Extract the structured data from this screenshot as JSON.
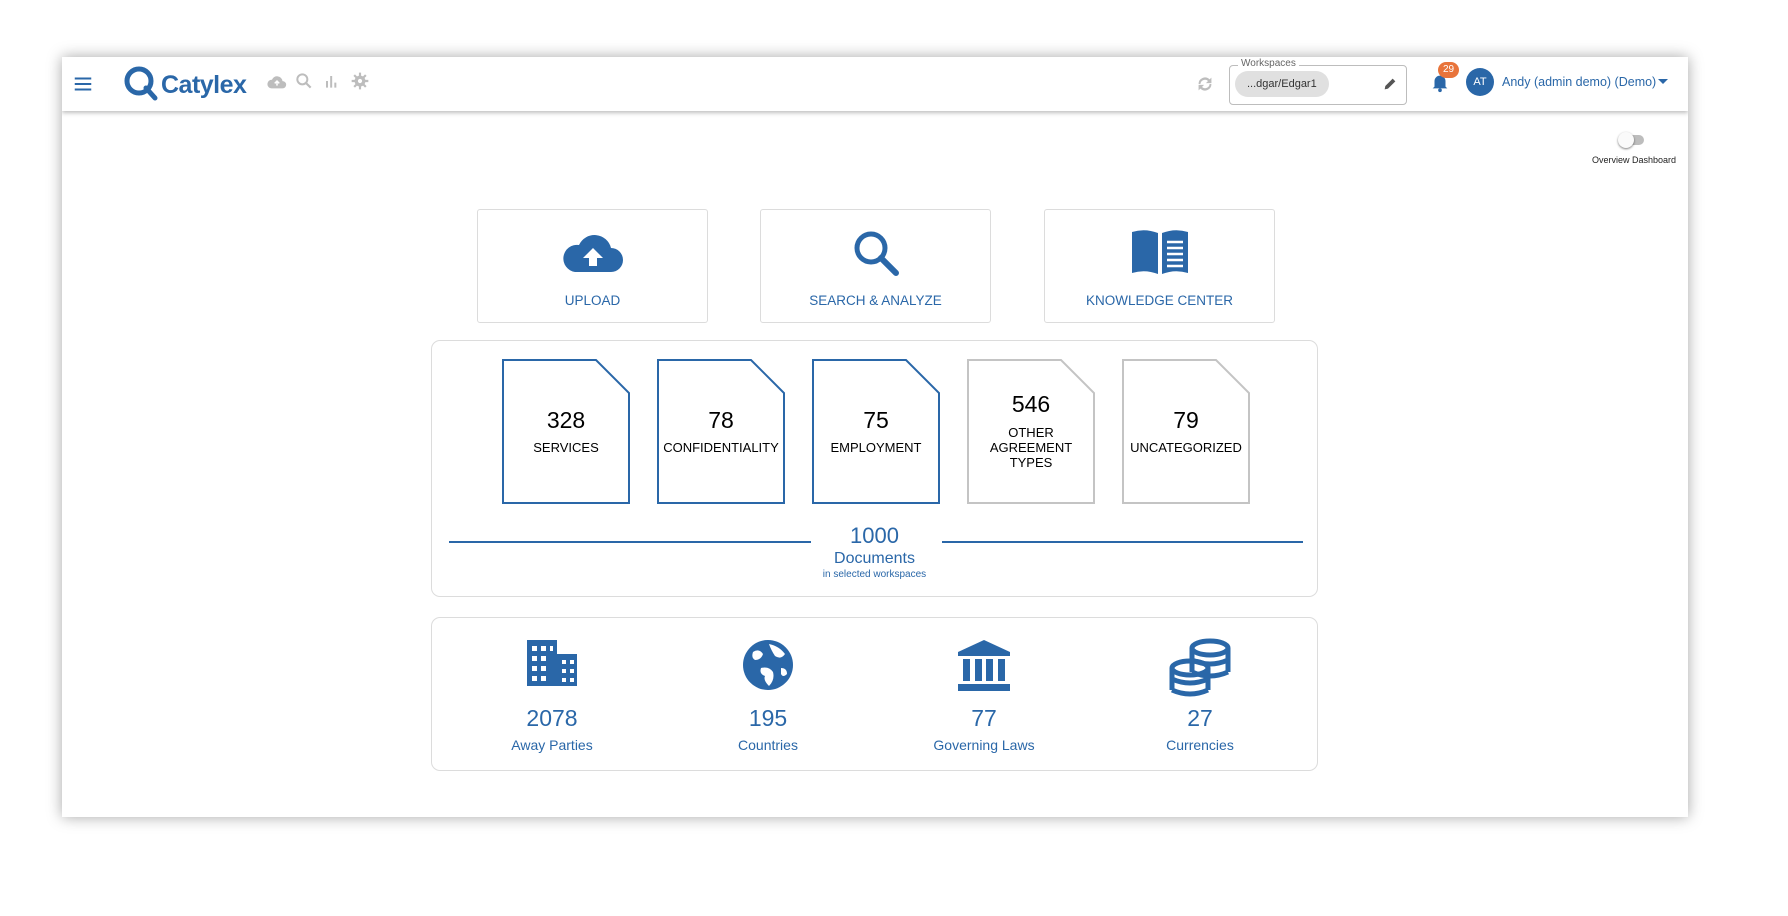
{
  "app": {
    "name": "Catylex"
  },
  "toolbar": {
    "icons": [
      "upload-cloud-icon",
      "search-icon",
      "bar-chart-icon",
      "settings-icon"
    ]
  },
  "workspaces": {
    "label": "Workspaces",
    "selected": "...dgar/Edgar1"
  },
  "notifications": {
    "count": "29"
  },
  "user": {
    "initials": "AT",
    "name": "Andy (admin demo) (Demo)"
  },
  "dashboard_toggle": {
    "label": "Overview Dashboard",
    "on": false
  },
  "actions": [
    {
      "label": "UPLOAD",
      "icon": "cloud-upload-icon"
    },
    {
      "label": "SEARCH & ANALYZE",
      "icon": "search-icon"
    },
    {
      "label": "KNOWLEDGE CENTER",
      "icon": "book-icon"
    }
  ],
  "documents": {
    "categories": [
      {
        "count": "328",
        "label": "SERVICES",
        "highlighted": true
      },
      {
        "count": "78",
        "label": "CONFIDENTIALITY",
        "highlighted": true
      },
      {
        "count": "75",
        "label": "EMPLOYMENT",
        "highlighted": true
      },
      {
        "count": "546",
        "label": "OTHER AGREEMENT TYPES",
        "label_lines": [
          "OTHER",
          "AGREEMENT",
          "TYPES"
        ],
        "highlighted": false
      },
      {
        "count": "79",
        "label": "UNCATEGORIZED",
        "highlighted": false
      }
    ],
    "total": "1000",
    "total_label": "Documents",
    "total_sub": "in selected workspaces"
  },
  "stats": [
    {
      "value": "2078",
      "label": "Away Parties",
      "icon": "building-icon"
    },
    {
      "value": "195",
      "label": "Countries",
      "icon": "globe-icon"
    },
    {
      "value": "77",
      "label": "Governing Laws",
      "icon": "bank-icon"
    },
    {
      "value": "27",
      "label": "Currencies",
      "icon": "coins-icon"
    }
  ],
  "colors": {
    "accent": "#2a67a8",
    "badge": "#e8743b",
    "border": "#dcdcdc"
  }
}
